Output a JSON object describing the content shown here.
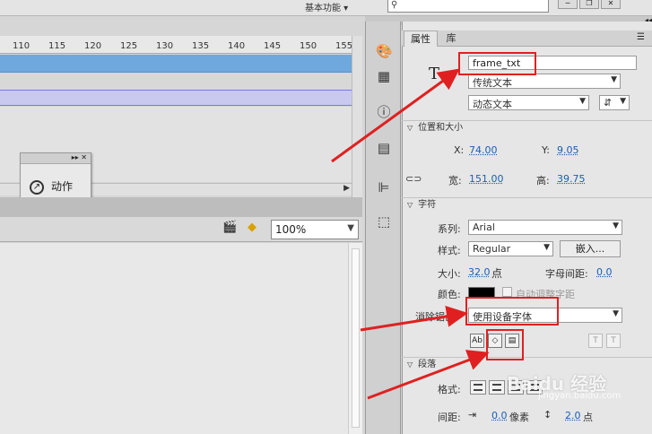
{
  "top_bar": {
    "workspace_label": "基本功能 ▾",
    "search_placeholder": "",
    "search_icon": "search-icon",
    "window_buttons": [
      "minimize",
      "restore",
      "close"
    ]
  },
  "timeline": {
    "ruler_ticks": [
      "110",
      "115",
      "120",
      "125",
      "130",
      "135",
      "140",
      "145",
      "150",
      "155"
    ]
  },
  "actions_panel": {
    "label": "动作",
    "icon": "arrow-circle-icon"
  },
  "stage_toolbar": {
    "zoom_value": "100%"
  },
  "properties": {
    "tabs": [
      "属性",
      "库"
    ],
    "instance_name": "frame_txt",
    "text_engine": "传统文本",
    "text_type": "动态文本",
    "position_section": "位置和大小",
    "x_label": "X:",
    "x_value": "74.00",
    "y_label": "Y:",
    "y_value": "9.05",
    "width_label": "宽:",
    "width_value": "151.00",
    "height_label": "高:",
    "height_value": "39.75",
    "character_section": "字符",
    "family_label": "系列:",
    "family_value": "Arial",
    "style_label": "样式:",
    "style_value": "Regular",
    "embed_label": "嵌入...",
    "size_label": "大小:",
    "size_value": "32.0",
    "size_unit": "点",
    "spacing_label": "字母间距:",
    "spacing_value": "0.0",
    "color_label": "颜色:",
    "color_value": "#000000",
    "autokern_label": "自动调整字距",
    "antialias_label": "消除锯齿:",
    "antialias_value": "使用设备字体",
    "paragraph_section": "段落",
    "format_label": "格式:",
    "spacing2_label": "间距:",
    "indent_value": "0.0",
    "indent_unit": "像素",
    "line_value": "2.0",
    "line_unit": "点"
  },
  "watermark": {
    "text": "Baidu 经验",
    "sub": "jingyan.baidu.com"
  },
  "colors": {
    "timeline_blue": "#6fa8dc",
    "annotation_red": "#e02020",
    "value_blue": "#1a5fb4"
  }
}
